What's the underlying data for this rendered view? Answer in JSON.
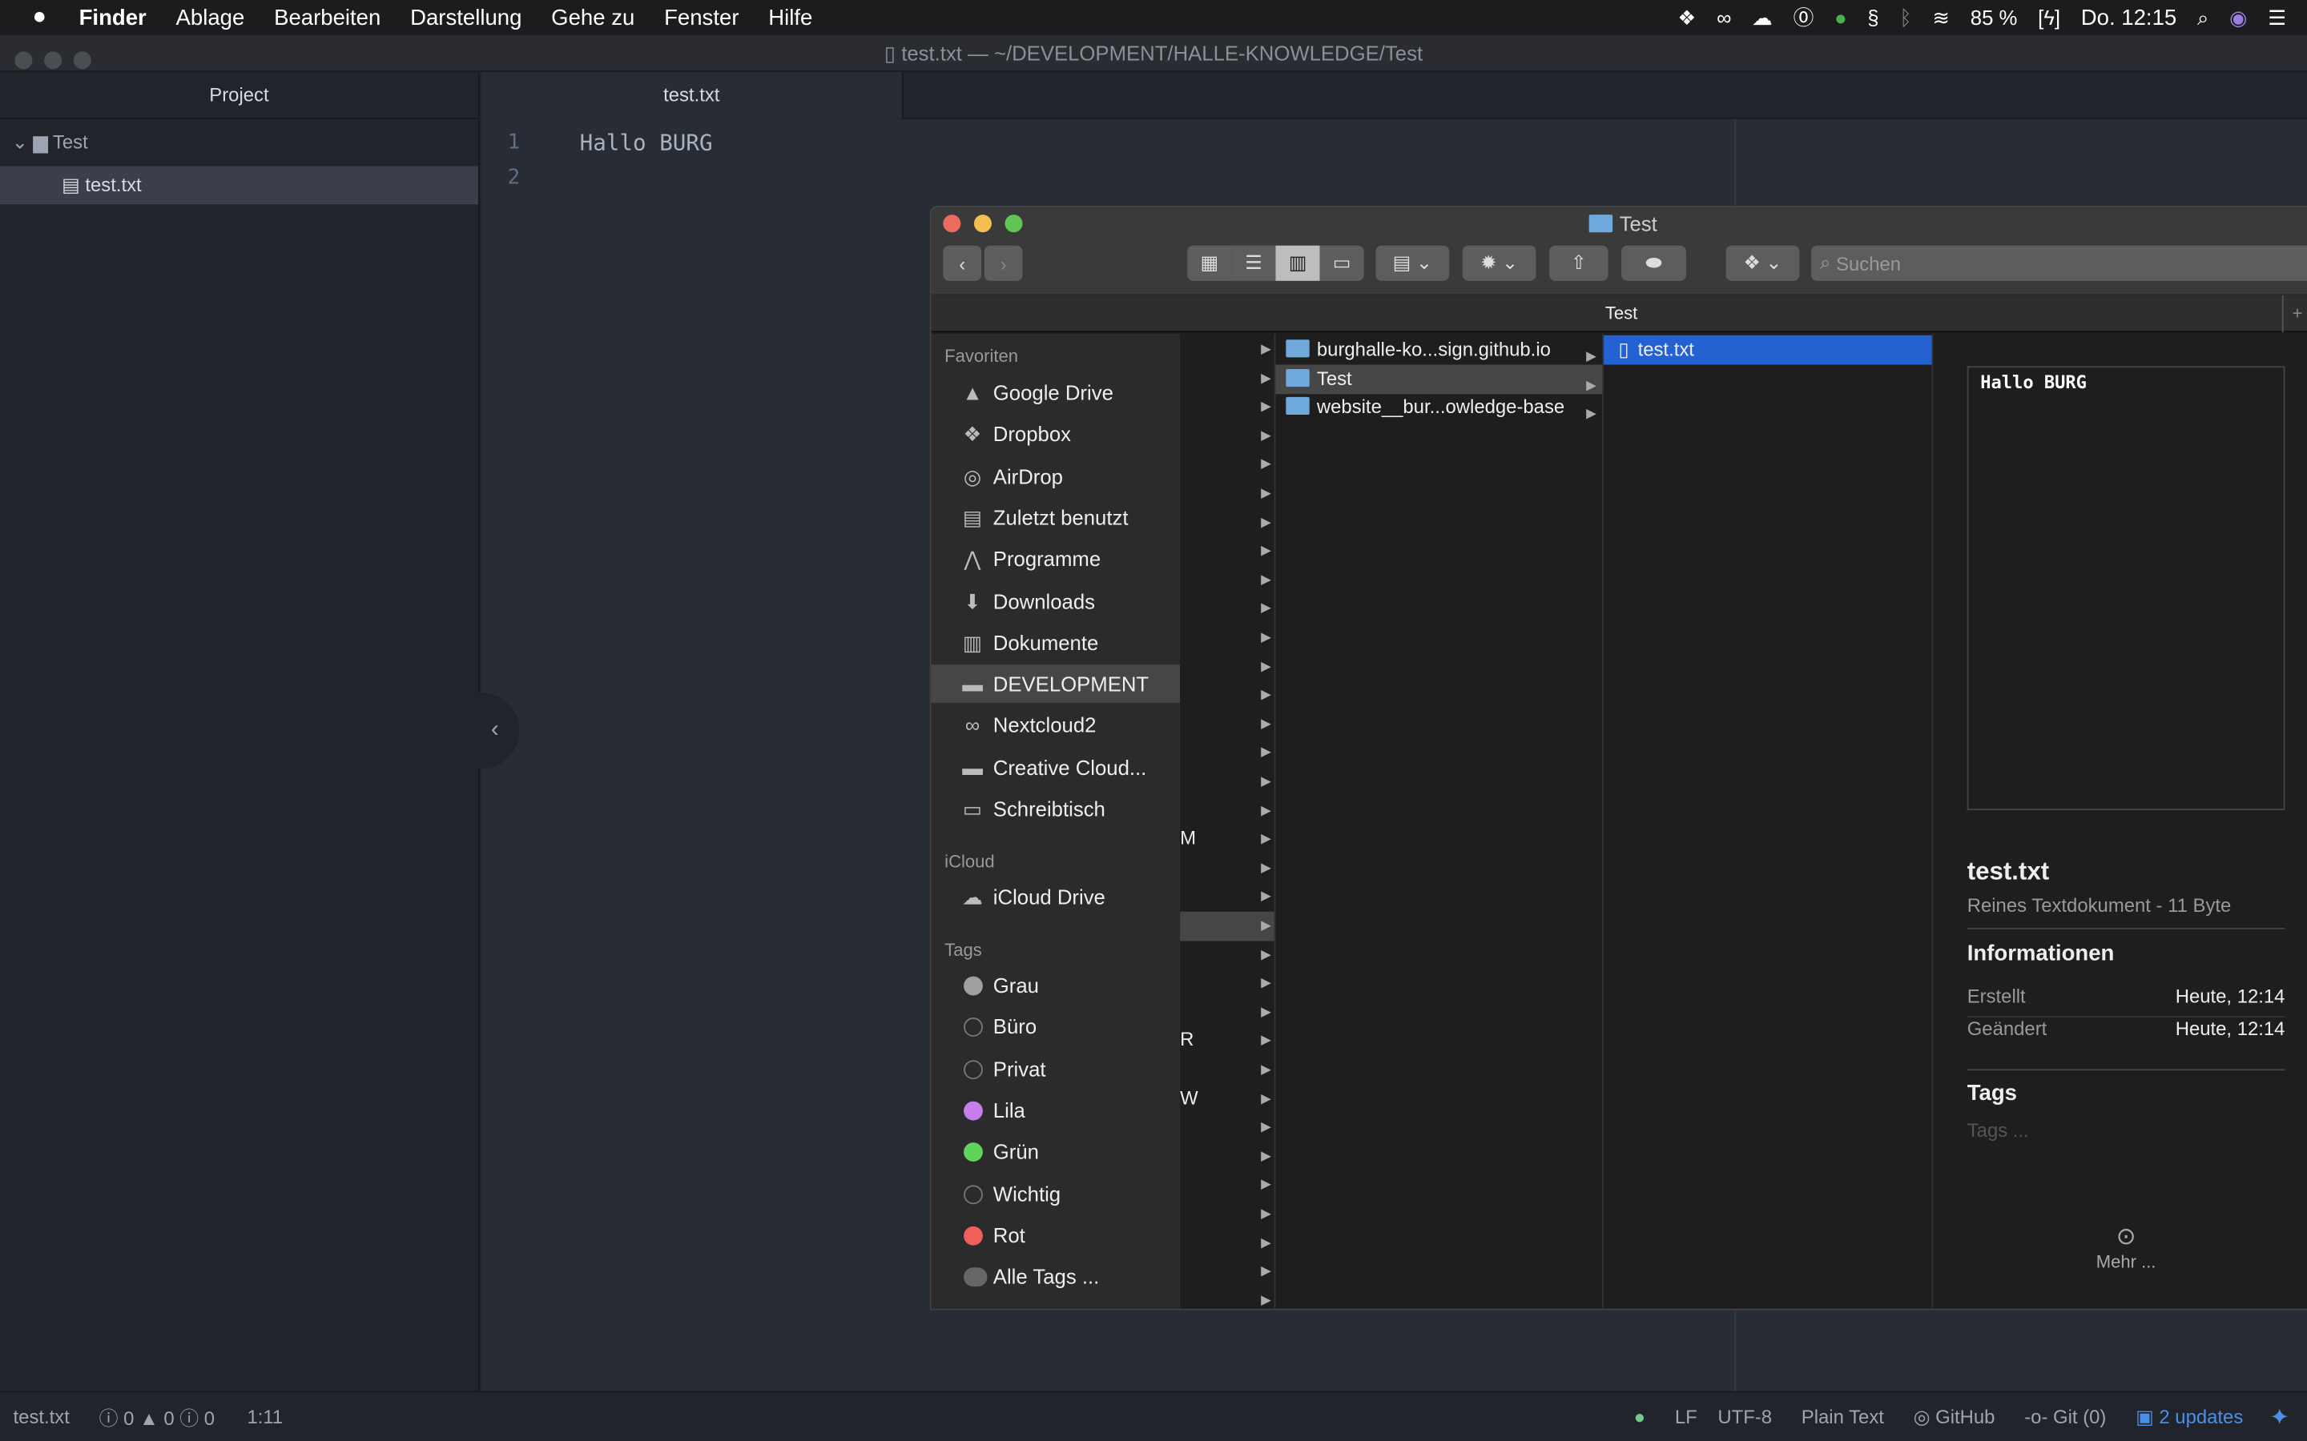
{
  "menubar": {
    "apple": "",
    "items": [
      "Finder",
      "Ablage",
      "Bearbeiten",
      "Darstellung",
      "Gehe zu",
      "Fenster",
      "Hilfe"
    ],
    "battery": "85 %",
    "clock": "Do. 12:15"
  },
  "atom": {
    "title": "test.txt — ~/DEVELOPMENT/HALLE-KNOWLEDGE/Test",
    "project_header": "Project",
    "tree": {
      "folder": "Test",
      "file": "test.txt"
    },
    "tab": "test.txt",
    "lines": [
      "1",
      "2"
    ],
    "code": "Hallo BURG",
    "status": {
      "file": "test.txt",
      "errors": "0",
      "warnings": "0",
      "infos": "0",
      "cursor": "1:11",
      "line_ending": "LF",
      "encoding": "UTF-8",
      "grammar": "Plain Text",
      "github": "GitHub",
      "git": "Git (0)",
      "updates": "2 updates"
    }
  },
  "finder": {
    "title": "Test",
    "search_placeholder": "Suchen",
    "path": "Test",
    "sidebar": {
      "favorites_header": "Favoriten",
      "favorites": [
        {
          "label": "Google Drive",
          "icon": "google-drive-icon"
        },
        {
          "label": "Dropbox",
          "icon": "dropbox-icon"
        },
        {
          "label": "AirDrop",
          "icon": "airdrop-icon"
        },
        {
          "label": "Zuletzt benutzt",
          "icon": "recent-icon"
        },
        {
          "label": "Programme",
          "icon": "applications-icon"
        },
        {
          "label": "Downloads",
          "icon": "downloads-icon"
        },
        {
          "label": "Dokumente",
          "icon": "documents-icon"
        },
        {
          "label": "DEVELOPMENT",
          "icon": "folder-icon",
          "selected": true
        },
        {
          "label": "Nextcloud2",
          "icon": "nextcloud-icon"
        },
        {
          "label": "Creative Cloud...",
          "icon": "folder-icon"
        },
        {
          "label": "Schreibtisch",
          "icon": "desktop-icon"
        }
      ],
      "icloud_header": "iCloud",
      "icloud": [
        {
          "label": "iCloud Drive",
          "icon": "icloud-icon"
        }
      ],
      "tags_header": "Tags",
      "tags": [
        {
          "label": "Grau",
          "color": "#a0a0a0"
        },
        {
          "label": "Büro",
          "color": ""
        },
        {
          "label": "Privat",
          "color": ""
        },
        {
          "label": "Lila",
          "color": "#c77dec"
        },
        {
          "label": "Grün",
          "color": "#5fd35a"
        },
        {
          "label": "Wichtig",
          "color": ""
        },
        {
          "label": "Rot",
          "color": "#f0605a"
        },
        {
          "label": "Alle Tags ...",
          "color": "all"
        }
      ]
    },
    "column1_fragments": [
      "M",
      "R",
      "W"
    ],
    "column2": [
      {
        "label": "burghalle-ko...sign.github.io"
      },
      {
        "label": "Test",
        "selected": true
      },
      {
        "label": "website__bur...owledge-base"
      }
    ],
    "column3": [
      {
        "label": "test.txt",
        "selected": true
      }
    ],
    "preview": {
      "content": "Hallo BURG",
      "name": "test.txt",
      "kind": "Reines Textdokument - 11 Byte",
      "info_header": "Informationen",
      "created_label": "Erstellt",
      "created": "Heute, 12:14",
      "modified_label": "Geändert",
      "modified": "Heute, 12:14",
      "tags_header": "Tags",
      "tags_placeholder": "Tags ...",
      "more": "Mehr ..."
    }
  },
  "colors": {
    "selection": "#2461d1",
    "accent_blue": "#4d8ee6"
  }
}
